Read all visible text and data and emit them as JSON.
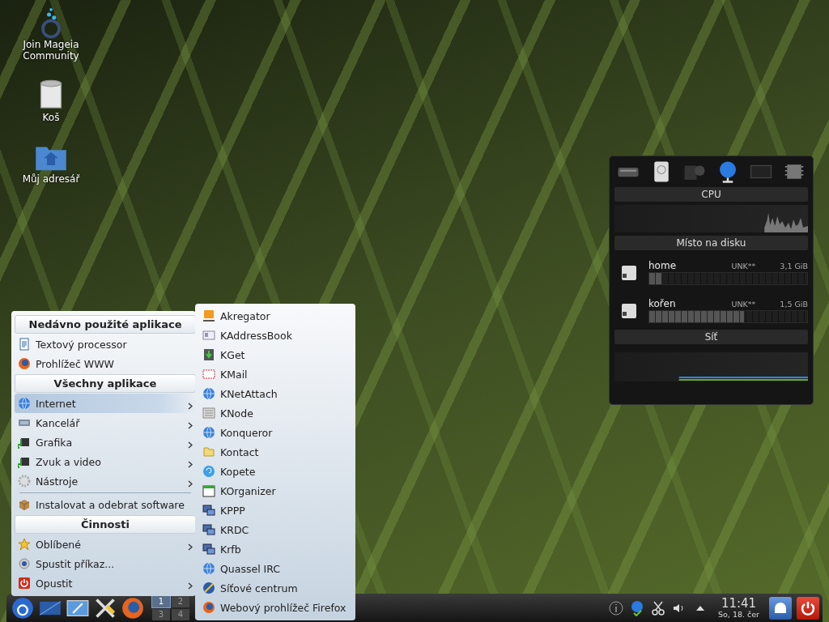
{
  "desktop_icons": [
    {
      "label": "Join Mageia Community"
    },
    {
      "label": "Koš"
    },
    {
      "label": "Můj adresář"
    }
  ],
  "menu": {
    "sections": [
      {
        "title": "Nedávno použité aplikace",
        "items": [
          {
            "label": "Textový processor",
            "submenu": false,
            "selected": false
          },
          {
            "label": "Prohlížeč WWW",
            "submenu": false,
            "selected": false
          }
        ]
      },
      {
        "title": "Všechny aplikace",
        "items": [
          {
            "label": "Internet",
            "submenu": true,
            "selected": true
          },
          {
            "label": "Kancelář",
            "submenu": true,
            "selected": false
          },
          {
            "label": "Grafika",
            "submenu": true,
            "selected": false
          },
          {
            "label": "Zvuk a video",
            "submenu": true,
            "selected": false
          },
          {
            "label": "Nástroje",
            "submenu": true,
            "selected": false
          }
        ]
      },
      {
        "items": [
          {
            "label": "Instalovat a odebrat software",
            "submenu": false,
            "selected": false
          }
        ]
      },
      {
        "title": "Činnosti",
        "items": [
          {
            "label": "Oblíbené",
            "submenu": true,
            "selected": false
          },
          {
            "label": "Spustit příkaz...",
            "submenu": false,
            "selected": false
          },
          {
            "label": "Opustit",
            "submenu": true,
            "selected": false
          }
        ]
      }
    ]
  },
  "submenu": {
    "items": [
      {
        "label": "Akregator"
      },
      {
        "label": "KAddressBook"
      },
      {
        "label": "KGet"
      },
      {
        "label": "KMail"
      },
      {
        "label": "KNetAttach"
      },
      {
        "label": "KNode"
      },
      {
        "label": "Konqueror"
      },
      {
        "label": "Kontact"
      },
      {
        "label": "Kopete"
      },
      {
        "label": "KOrganizer"
      },
      {
        "label": "KPPP"
      },
      {
        "label": "KRDC"
      },
      {
        "label": "Krfb"
      },
      {
        "label": "Quassel IRC"
      },
      {
        "label": "Síťové centrum"
      },
      {
        "label": "Webový prohlížeč Firefox"
      }
    ]
  },
  "monitor": {
    "cpu": {
      "title": "CPU"
    },
    "disk": {
      "title": "Místo na disku",
      "disks": [
        {
          "name": "home",
          "status": "UNK**",
          "size": "3,1 GiB",
          "level": 0.08
        },
        {
          "name": "kořen",
          "status": "UNK**",
          "size": "1,5 GiB",
          "level": 0.6
        }
      ]
    },
    "network": {
      "title": "Síť"
    }
  },
  "panel": {
    "pager": [
      {
        "label": "1",
        "selected": true
      },
      {
        "label": "2",
        "selected": false
      },
      {
        "label": "3",
        "selected": false
      },
      {
        "label": "4",
        "selected": false
      }
    ],
    "clock": {
      "time": "11:41",
      "date": "So, 18. čer"
    }
  }
}
